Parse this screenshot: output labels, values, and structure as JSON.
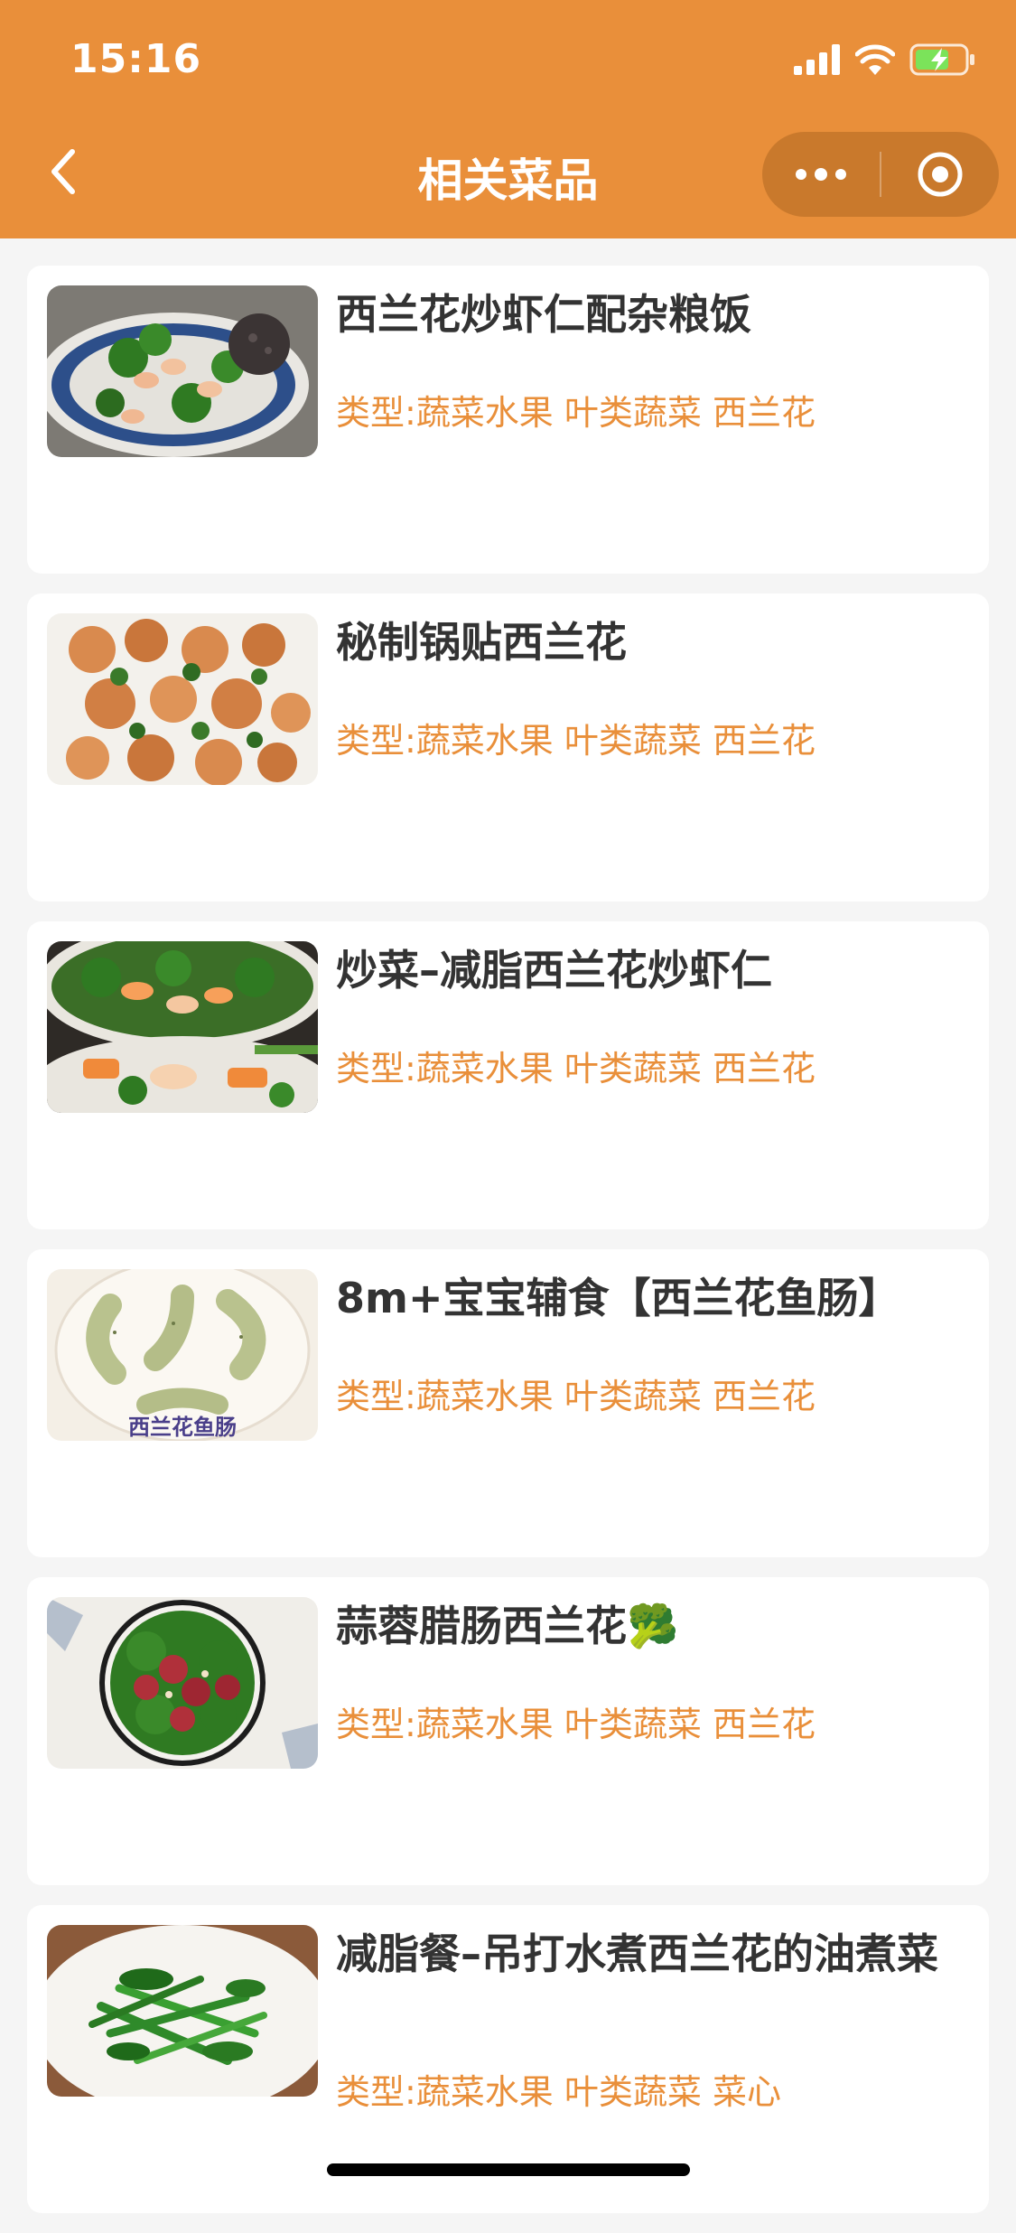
{
  "status_bar": {
    "time": "15:16"
  },
  "nav": {
    "title": "相关菜品"
  },
  "colors": {
    "accent": "#E98F3A",
    "background": "#f5f5f5",
    "card": "#ffffff",
    "text": "#333333"
  },
  "dishes": [
    {
      "name": "西兰花炒虾仁配杂粮饭",
      "type": "类型:蔬菜水果 叶类蔬菜 西兰花"
    },
    {
      "name": "秘制锅贴西兰花",
      "type": "类型:蔬菜水果 叶类蔬菜 西兰花"
    },
    {
      "name": "炒菜–减脂西兰花炒虾仁",
      "type": "类型:蔬菜水果 叶类蔬菜 西兰花"
    },
    {
      "name": "8m+宝宝辅食【西兰花鱼肠】",
      "type": "类型:蔬菜水果 叶类蔬菜 西兰花",
      "image_text": "西兰花鱼肠"
    },
    {
      "name": "蒜蓉腊肠西兰花🥦",
      "type": "类型:蔬菜水果 叶类蔬菜 西兰花"
    },
    {
      "name": "减脂餐–吊打水煮西兰花的油煮菜",
      "type": "类型:蔬菜水果 叶类蔬菜 菜心"
    }
  ]
}
